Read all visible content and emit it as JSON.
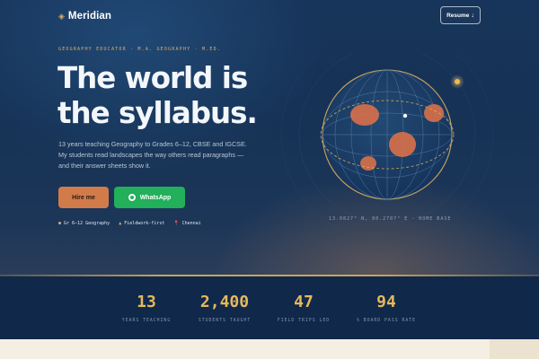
{
  "header": {
    "brand_mark": "◈",
    "brand_name": "Meridian",
    "resume_label": "Resume",
    "resume_arrow": "↓"
  },
  "hero": {
    "eyebrow": "GEOGRAPHY EDUCATOR · M.A. GEOGRAPHY · M.ED.",
    "headline_line1": "The world is",
    "headline_line2": "the syllabus.",
    "lede_line1": "13 years teaching Geography to Grades 6–12, CBSE and IGCSE.",
    "lede_line2": "My students read landscapes the way others read paragraphs —",
    "lede_line3": "and their answer sheets show it.",
    "hire_label": "Hire me",
    "whatsapp_label": "WhatsApp",
    "meta": [
      {
        "icon": "●",
        "icon_name": "dot-icon",
        "text": "Gr 6–12 Geography"
      },
      {
        "icon": "▲",
        "icon_name": "mountain-icon",
        "text": "Fieldwork-first"
      },
      {
        "icon": "📍",
        "icon_name": "location-pin-icon",
        "text": "Chennai"
      }
    ],
    "coords": "13.0827° N, 80.2707° E · HOME BASE"
  },
  "stats": [
    {
      "value": "13",
      "label": "YEARS TEACHING"
    },
    {
      "value": "2,400",
      "label": "STUDENTS TAUGHT"
    },
    {
      "value": "47",
      "label": "FIELD TRIPS LED"
    },
    {
      "value": "94",
      "label": "% BOARD PASS RATE"
    }
  ],
  "colors": {
    "background": "#163255",
    "accent_gold": "#e6b85c",
    "hire_button": "#d17b4b",
    "whatsapp_button": "#22b05a",
    "stats_band": "#10294a",
    "cream": "#f4efe2"
  }
}
